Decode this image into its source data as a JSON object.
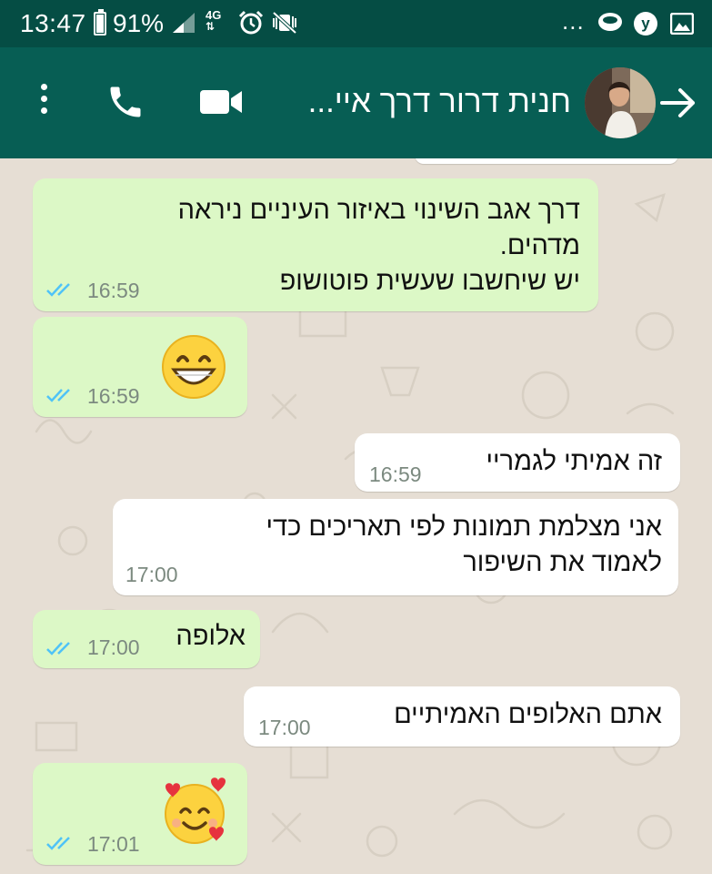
{
  "status_bar": {
    "time": "13:47",
    "battery": "91%",
    "battery_level": 0.91,
    "network": "4G",
    "overflow": "...",
    "y_badge": "y",
    "icons": [
      "battery-icon",
      "signal-icon",
      "4g-data-icon",
      "alarm-icon",
      "vibrate-mute-icon",
      "chat-notification-icon",
      "y-app-icon",
      "gallery-icon"
    ]
  },
  "app_bar": {
    "title": "חנית דרור דרך איי...",
    "icons": [
      "more-options-icon",
      "phone-call-icon",
      "video-call-icon",
      "back-arrow-icon"
    ],
    "colors": {
      "bar": "#075e54",
      "status": "#054d44"
    }
  },
  "messages": [
    {
      "direction": "out",
      "lines": [
        "דרך אגב השינוי באיזור העיניים ניראה",
        "מדהים.",
        "יש שיחשבו שעשית פוטושופ"
      ],
      "time": "16:59",
      "read": true
    },
    {
      "direction": "out",
      "emoji": "grinning-face-emoji",
      "time": "16:59",
      "read": true
    },
    {
      "direction": "in",
      "lines": [
        "זה אמיתי לגמריי"
      ],
      "time": "16:59"
    },
    {
      "direction": "in",
      "lines": [
        "אני מצלמת תמונות לפי תאריכים כדי",
        "לאמוד את השיפור"
      ],
      "time": "17:00"
    },
    {
      "direction": "out",
      "lines": [
        "אלופה"
      ],
      "time": "17:00",
      "read": true
    },
    {
      "direction": "in",
      "lines": [
        "אתם האלופים האמיתיים"
      ],
      "time": "17:00"
    },
    {
      "direction": "out",
      "emoji": "smiling-face-with-hearts-emoji",
      "time": "17:01",
      "read": true
    }
  ],
  "colors": {
    "outgoing_bubble": "#dcf8c6",
    "incoming_bubble": "#ffffff",
    "read_ticks": "#4fc3f7",
    "chat_background": "#e6ded4"
  }
}
